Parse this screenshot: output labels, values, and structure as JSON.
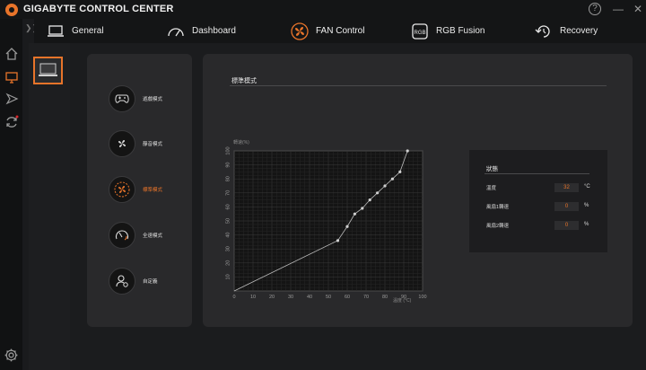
{
  "app": {
    "title": "GIGABYTE CONTROL CENTER"
  },
  "titlebar": {
    "help_icon": "question-circle-icon",
    "minimize_icon": "minimize-icon",
    "close_icon": "close-icon"
  },
  "nav": {
    "items": [
      {
        "label": "General",
        "icon": "laptop-icon",
        "active": false
      },
      {
        "label": "Dashboard",
        "icon": "gauge-icon",
        "active": false
      },
      {
        "label": "FAN Control",
        "icon": "fan-icon",
        "active": true
      },
      {
        "label": "RGB Fusion",
        "icon": "rgb-icon",
        "active": false
      },
      {
        "label": "Recovery",
        "icon": "recovery-icon",
        "active": false
      }
    ]
  },
  "rail": {
    "icons": [
      "home-icon",
      "monitor-icon",
      "send-icon",
      "sync-icon",
      "settings-icon"
    ]
  },
  "device": {
    "icon": "laptop-device-icon"
  },
  "modes": [
    {
      "label": "遊戲模式",
      "icon": "gamepad-icon",
      "active": false
    },
    {
      "label": "靜音模式",
      "icon": "fan-quiet-icon",
      "active": false
    },
    {
      "label": "標準模式",
      "icon": "fan-normal-icon",
      "active": true
    },
    {
      "label": "全速模式",
      "icon": "speedometer-icon",
      "active": false
    },
    {
      "label": "自定義",
      "icon": "user-custom-icon",
      "active": false
    }
  ],
  "main": {
    "section_title": "標準模式"
  },
  "chart_data": {
    "type": "line",
    "ylabel": "轉速(%)",
    "xlabel": "溫度 (°C)",
    "xlim": [
      0,
      100
    ],
    "ylim": [
      0,
      100
    ],
    "x_ticks": [
      0,
      10,
      20,
      30,
      40,
      50,
      60,
      70,
      80,
      90,
      100
    ],
    "y_ticks": [
      10,
      20,
      30,
      40,
      50,
      60,
      70,
      80,
      90,
      100
    ],
    "grid": true,
    "series": [
      {
        "x": [
          0,
          55,
          60,
          64,
          68,
          72,
          76,
          80,
          84,
          88,
          92
        ],
        "y": [
          0,
          36,
          46,
          55,
          59,
          65,
          70,
          75,
          80,
          85,
          100
        ]
      }
    ]
  },
  "status": {
    "title": "狀態",
    "rows": [
      {
        "label": "溫度",
        "value": "32",
        "unit": "°C"
      },
      {
        "label": "風扇1轉速",
        "value": "0",
        "unit": "%"
      },
      {
        "label": "風扇2轉速",
        "value": "0",
        "unit": "%"
      }
    ]
  },
  "colors": {
    "accent": "#e8742a",
    "background": "#1b1c1e",
    "panel": "#29292b"
  }
}
